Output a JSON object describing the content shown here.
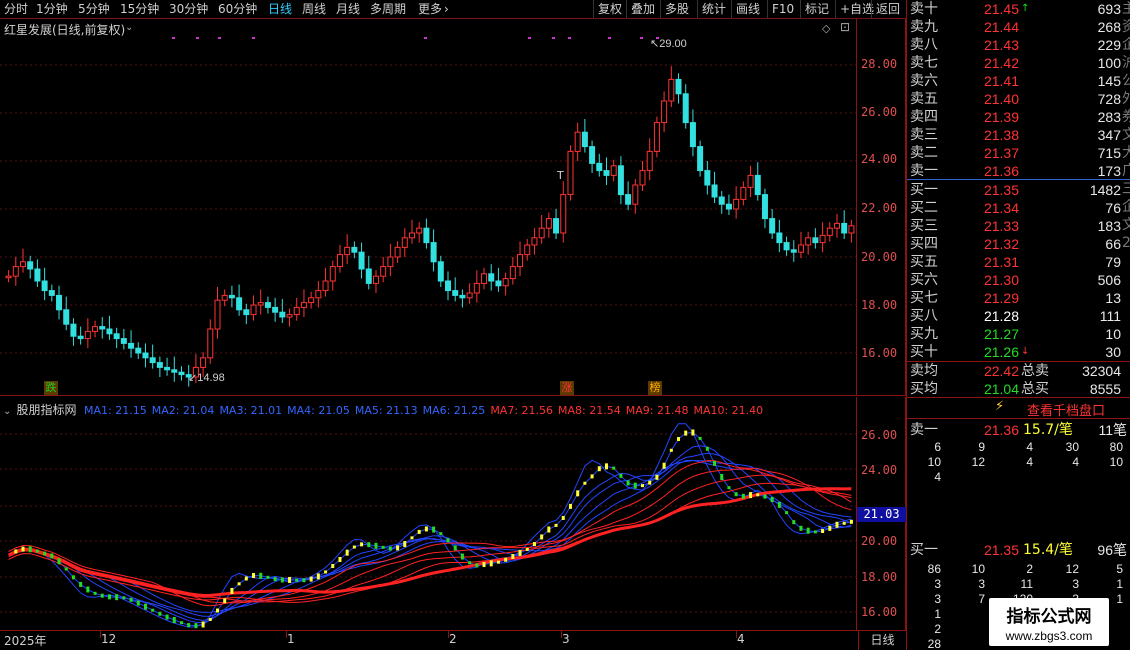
{
  "toolbar": {
    "periods": [
      "分时",
      "1分钟",
      "5分钟",
      "15分钟",
      "30分钟",
      "60分钟",
      "日线",
      "周线",
      "月线",
      "多周期",
      "更多"
    ],
    "active_period": "日线",
    "more_arrow": "›",
    "right_buttons": [
      "复权",
      "叠加",
      "多股",
      "统计",
      "画线",
      "F10",
      "标记",
      "+自选",
      "返回"
    ]
  },
  "main_chart": {
    "title": "红星发展(日线,前复权)",
    "high_label": "29.00",
    "low_label": "14.98",
    "t_marker": "T",
    "y_ticks": [
      "28.00",
      "26.00",
      "24.00",
      "22.00",
      "20.00",
      "18.00",
      "16.00"
    ],
    "badges": [
      {
        "text": "跌",
        "color": "#22cc22"
      },
      {
        "text": "涨",
        "color": "#ff3333"
      },
      {
        "text": "榜",
        "color": "#ffaa00"
      }
    ]
  },
  "indicator": {
    "name": "股朋指标网",
    "ma_legend": [
      {
        "label": "MA1: 21.15",
        "color": "#3366ff"
      },
      {
        "label": "MA2: 21.04",
        "color": "#3366ff"
      },
      {
        "label": "MA3: 21.01",
        "color": "#3366ff"
      },
      {
        "label": "MA4: 21.05",
        "color": "#3366ff"
      },
      {
        "label": "MA5: 21.13",
        "color": "#3366ff"
      },
      {
        "label": "MA6: 21.25",
        "color": "#3366ff"
      },
      {
        "label": "MA7: 21.56",
        "color": "#ff3333"
      },
      {
        "label": "MA8: 21.54",
        "color": "#ff3333"
      },
      {
        "label": "MA9: 21.48",
        "color": "#ff3333"
      },
      {
        "label": "MA10: 21.40",
        "color": "#ff3333"
      }
    ],
    "y_ticks": [
      "26.00",
      "24.00",
      "22.00",
      "20.00",
      "18.00",
      "16.00"
    ],
    "current_value": "21.03"
  },
  "x_axis": {
    "labels": [
      "2025年",
      "12",
      "1",
      "2",
      "3",
      "4"
    ],
    "period_label": "日线"
  },
  "order_book": {
    "asks": [
      {
        "label": "卖十",
        "price": "21.45",
        "vol": "693",
        "arrow": "↑"
      },
      {
        "label": "卖九",
        "price": "21.44",
        "vol": "268"
      },
      {
        "label": "卖八",
        "price": "21.43",
        "vol": "229"
      },
      {
        "label": "卖七",
        "price": "21.42",
        "vol": "100"
      },
      {
        "label": "卖六",
        "price": "21.41",
        "vol": "145"
      },
      {
        "label": "卖五",
        "price": "21.40",
        "vol": "728"
      },
      {
        "label": "卖四",
        "price": "21.39",
        "vol": "283"
      },
      {
        "label": "卖三",
        "price": "21.38",
        "vol": "347"
      },
      {
        "label": "卖二",
        "price": "21.37",
        "vol": "715"
      },
      {
        "label": "卖一",
        "price": "21.36",
        "vol": "173"
      }
    ],
    "bids": [
      {
        "label": "买一",
        "price": "21.35",
        "vol": "1482",
        "color": "red"
      },
      {
        "label": "买二",
        "price": "21.34",
        "vol": "76",
        "color": "red"
      },
      {
        "label": "买三",
        "price": "21.33",
        "vol": "183",
        "color": "red"
      },
      {
        "label": "买四",
        "price": "21.32",
        "vol": "66",
        "color": "red"
      },
      {
        "label": "买五",
        "price": "21.31",
        "vol": "79",
        "color": "red"
      },
      {
        "label": "买六",
        "price": "21.30",
        "vol": "506",
        "color": "red"
      },
      {
        "label": "买七",
        "price": "21.29",
        "vol": "13",
        "color": "red"
      },
      {
        "label": "买八",
        "price": "21.28",
        "vol": "111",
        "color": "white"
      },
      {
        "label": "买九",
        "price": "21.27",
        "vol": "10",
        "color": "green"
      },
      {
        "label": "买十",
        "price": "21.26",
        "vol": "30",
        "color": "green",
        "arrow": "↓"
      }
    ],
    "avg_sell": {
      "label": "卖均",
      "price": "22.42",
      "total_label": "总卖",
      "total": "32304"
    },
    "avg_buy": {
      "label": "买均",
      "price": "21.04",
      "total_label": "总买",
      "total": "8555"
    }
  },
  "level2": {
    "button_label": "查看千档盘口",
    "ask_summary": {
      "label": "卖一",
      "price": "21.36",
      "avg": "15.7/笔",
      "count": "11笔"
    },
    "ask_queue": [
      [
        "6",
        "9",
        "4",
        "30",
        "80"
      ],
      [
        "10",
        "12",
        "4",
        "4",
        "10"
      ],
      [
        "4"
      ]
    ],
    "bid_summary": {
      "label": "买一",
      "price": "21.35",
      "avg": "15.4/笔",
      "count": "96笔"
    },
    "bid_queue": [
      [
        "86",
        "10",
        "2",
        "12",
        "5"
      ],
      [
        "3",
        "3",
        "11",
        "3",
        "1"
      ],
      [
        "3",
        "7",
        "120",
        "3",
        "1"
      ],
      [
        "1"
      ],
      [
        "2"
      ],
      [
        "28"
      ]
    ]
  },
  "watermark": {
    "title": "指标公式网",
    "url": "www.zbgs3.com"
  },
  "right_edge_text": "主 资 企 沪 公 外 券 文 大 广 三 企 文 2"
}
